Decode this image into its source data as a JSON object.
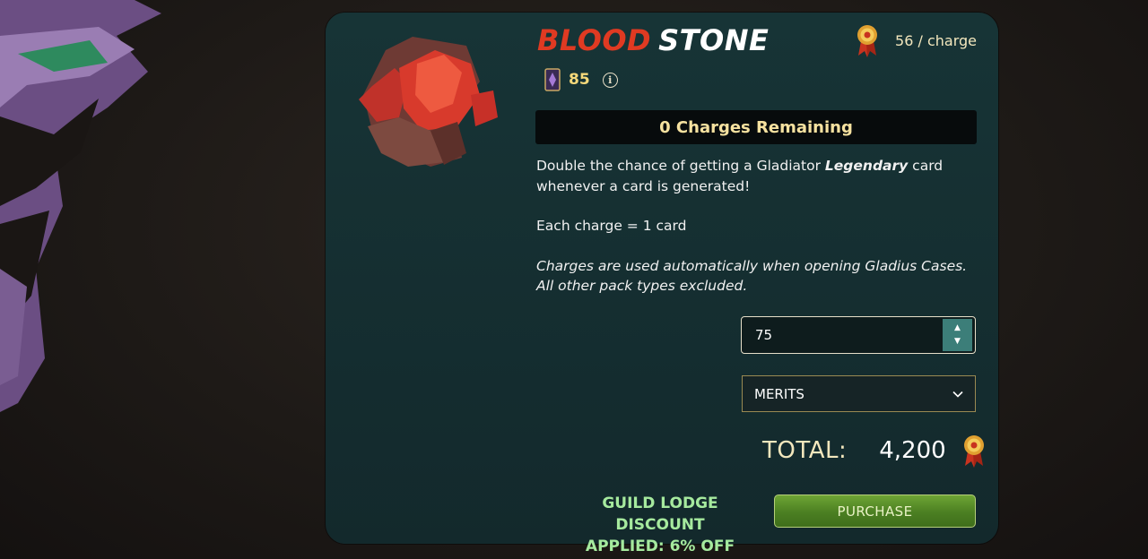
{
  "item": {
    "title_part1": "BLOOD",
    "title_part2": "STONE",
    "price_per_charge": "56 / charge",
    "level": "85",
    "info_icon_glyph": "i",
    "charges_remaining": "0 Charges Remaining"
  },
  "description": {
    "line1_pre": "Double the chance of getting a Gladiator ",
    "line1_em": "Legendary",
    "line1_post": " card",
    "line2": "whenever a card is generated!",
    "charge_rule": "Each charge = 1 card",
    "note_line1": "Charges are used automatically when opening Gladius Cases.",
    "note_line2": "All other pack types excluded."
  },
  "purchase_form": {
    "quantity_value": "75",
    "stepper_up": "▲",
    "stepper_down": "▼",
    "currency_selected": "MERITS",
    "total_label": "TOTAL:",
    "total_value": "4,200",
    "discount_line1": "GUILD LODGE DISCOUNT",
    "discount_line2": "APPLIED: 6% OFF",
    "purchase_label": "PURCHASE"
  },
  "icons": {
    "currency": "merits-medal-icon",
    "level": "card-level-icon",
    "info": "info-icon",
    "dropdown": "chevron-down-icon",
    "item": "blood-stone-icon"
  },
  "colors": {
    "panel_bg": "#173436",
    "title_red": "#e03a22",
    "accent_gold": "#f3e7bd",
    "discount_green": "#a6ea9e",
    "purchase_green": "#4b7f22"
  }
}
